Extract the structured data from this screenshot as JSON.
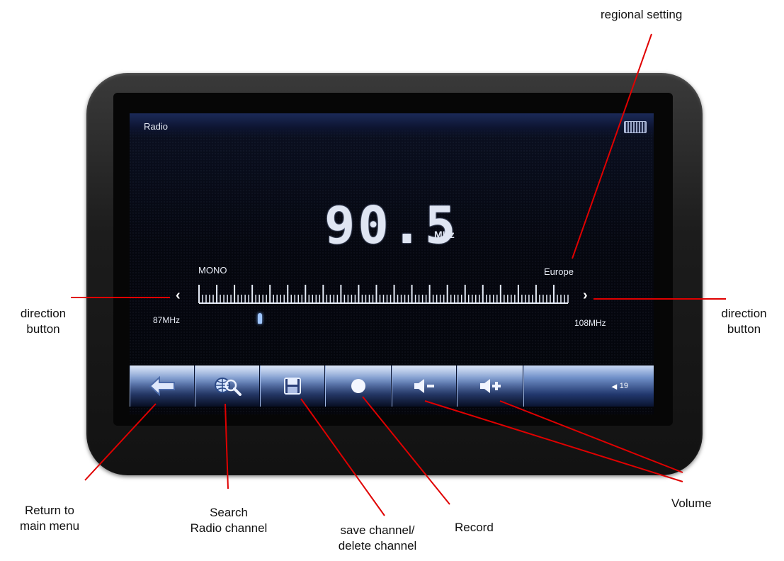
{
  "screen": {
    "title": "Radio",
    "frequency": "90.5",
    "unit": "MHz",
    "mode": "MONO",
    "region": "Europe",
    "band_min": "87MHz",
    "band_max": "108MHz",
    "tuned_frequency_mhz": 90.5,
    "volume_level": "19"
  },
  "toolbar": {
    "buttons": [
      {
        "icon": "back-arrow-icon"
      },
      {
        "icon": "globe-search-icon"
      },
      {
        "icon": "floppy-disk-icon"
      },
      {
        "icon": "record-circle-icon"
      },
      {
        "icon": "volume-down-icon"
      },
      {
        "icon": "volume-up-icon"
      }
    ],
    "volume_icon": "speaker-icon"
  },
  "annotations": {
    "regional_setting": "regional setting",
    "direction_left": [
      "direction",
      "button"
    ],
    "direction_right": [
      "direction",
      "button"
    ],
    "return": [
      "Return to",
      "main menu"
    ],
    "search": [
      "Search",
      "Radio channel"
    ],
    "save": [
      "save channel/",
      "delete channel"
    ],
    "record": "Record",
    "volume": "Volume"
  },
  "colors": {
    "callout_line": "#e00000",
    "screen_text": "#e8ecf6"
  }
}
